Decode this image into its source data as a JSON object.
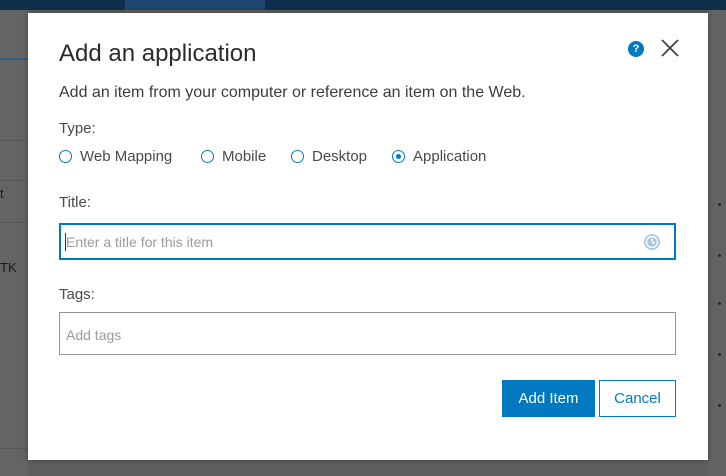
{
  "background": {
    "row_texts": [
      "t",
      "TK"
    ]
  },
  "dialog": {
    "title": "Add an application",
    "help_icon": "question-circle-icon",
    "close_icon": "close-icon",
    "description": "Add an item from your computer or reference an item on the Web.",
    "type_label": "Type:",
    "type_options": [
      {
        "label": "Web Mapping",
        "selected": false
      },
      {
        "label": "Mobile",
        "selected": false
      },
      {
        "label": "Desktop",
        "selected": false
      },
      {
        "label": "Application",
        "selected": true
      }
    ],
    "title_label": "Title:",
    "title_field": {
      "value": "",
      "placeholder": "Enter a title for this item",
      "icon": "clock-icon"
    },
    "tags_label": "Tags:",
    "tags_field": {
      "value": "",
      "placeholder": "Add tags"
    },
    "add_button": "Add Item",
    "cancel_button": "Cancel"
  },
  "colors": {
    "accent": "#0079c1",
    "overlay": "#5f5f5f"
  }
}
